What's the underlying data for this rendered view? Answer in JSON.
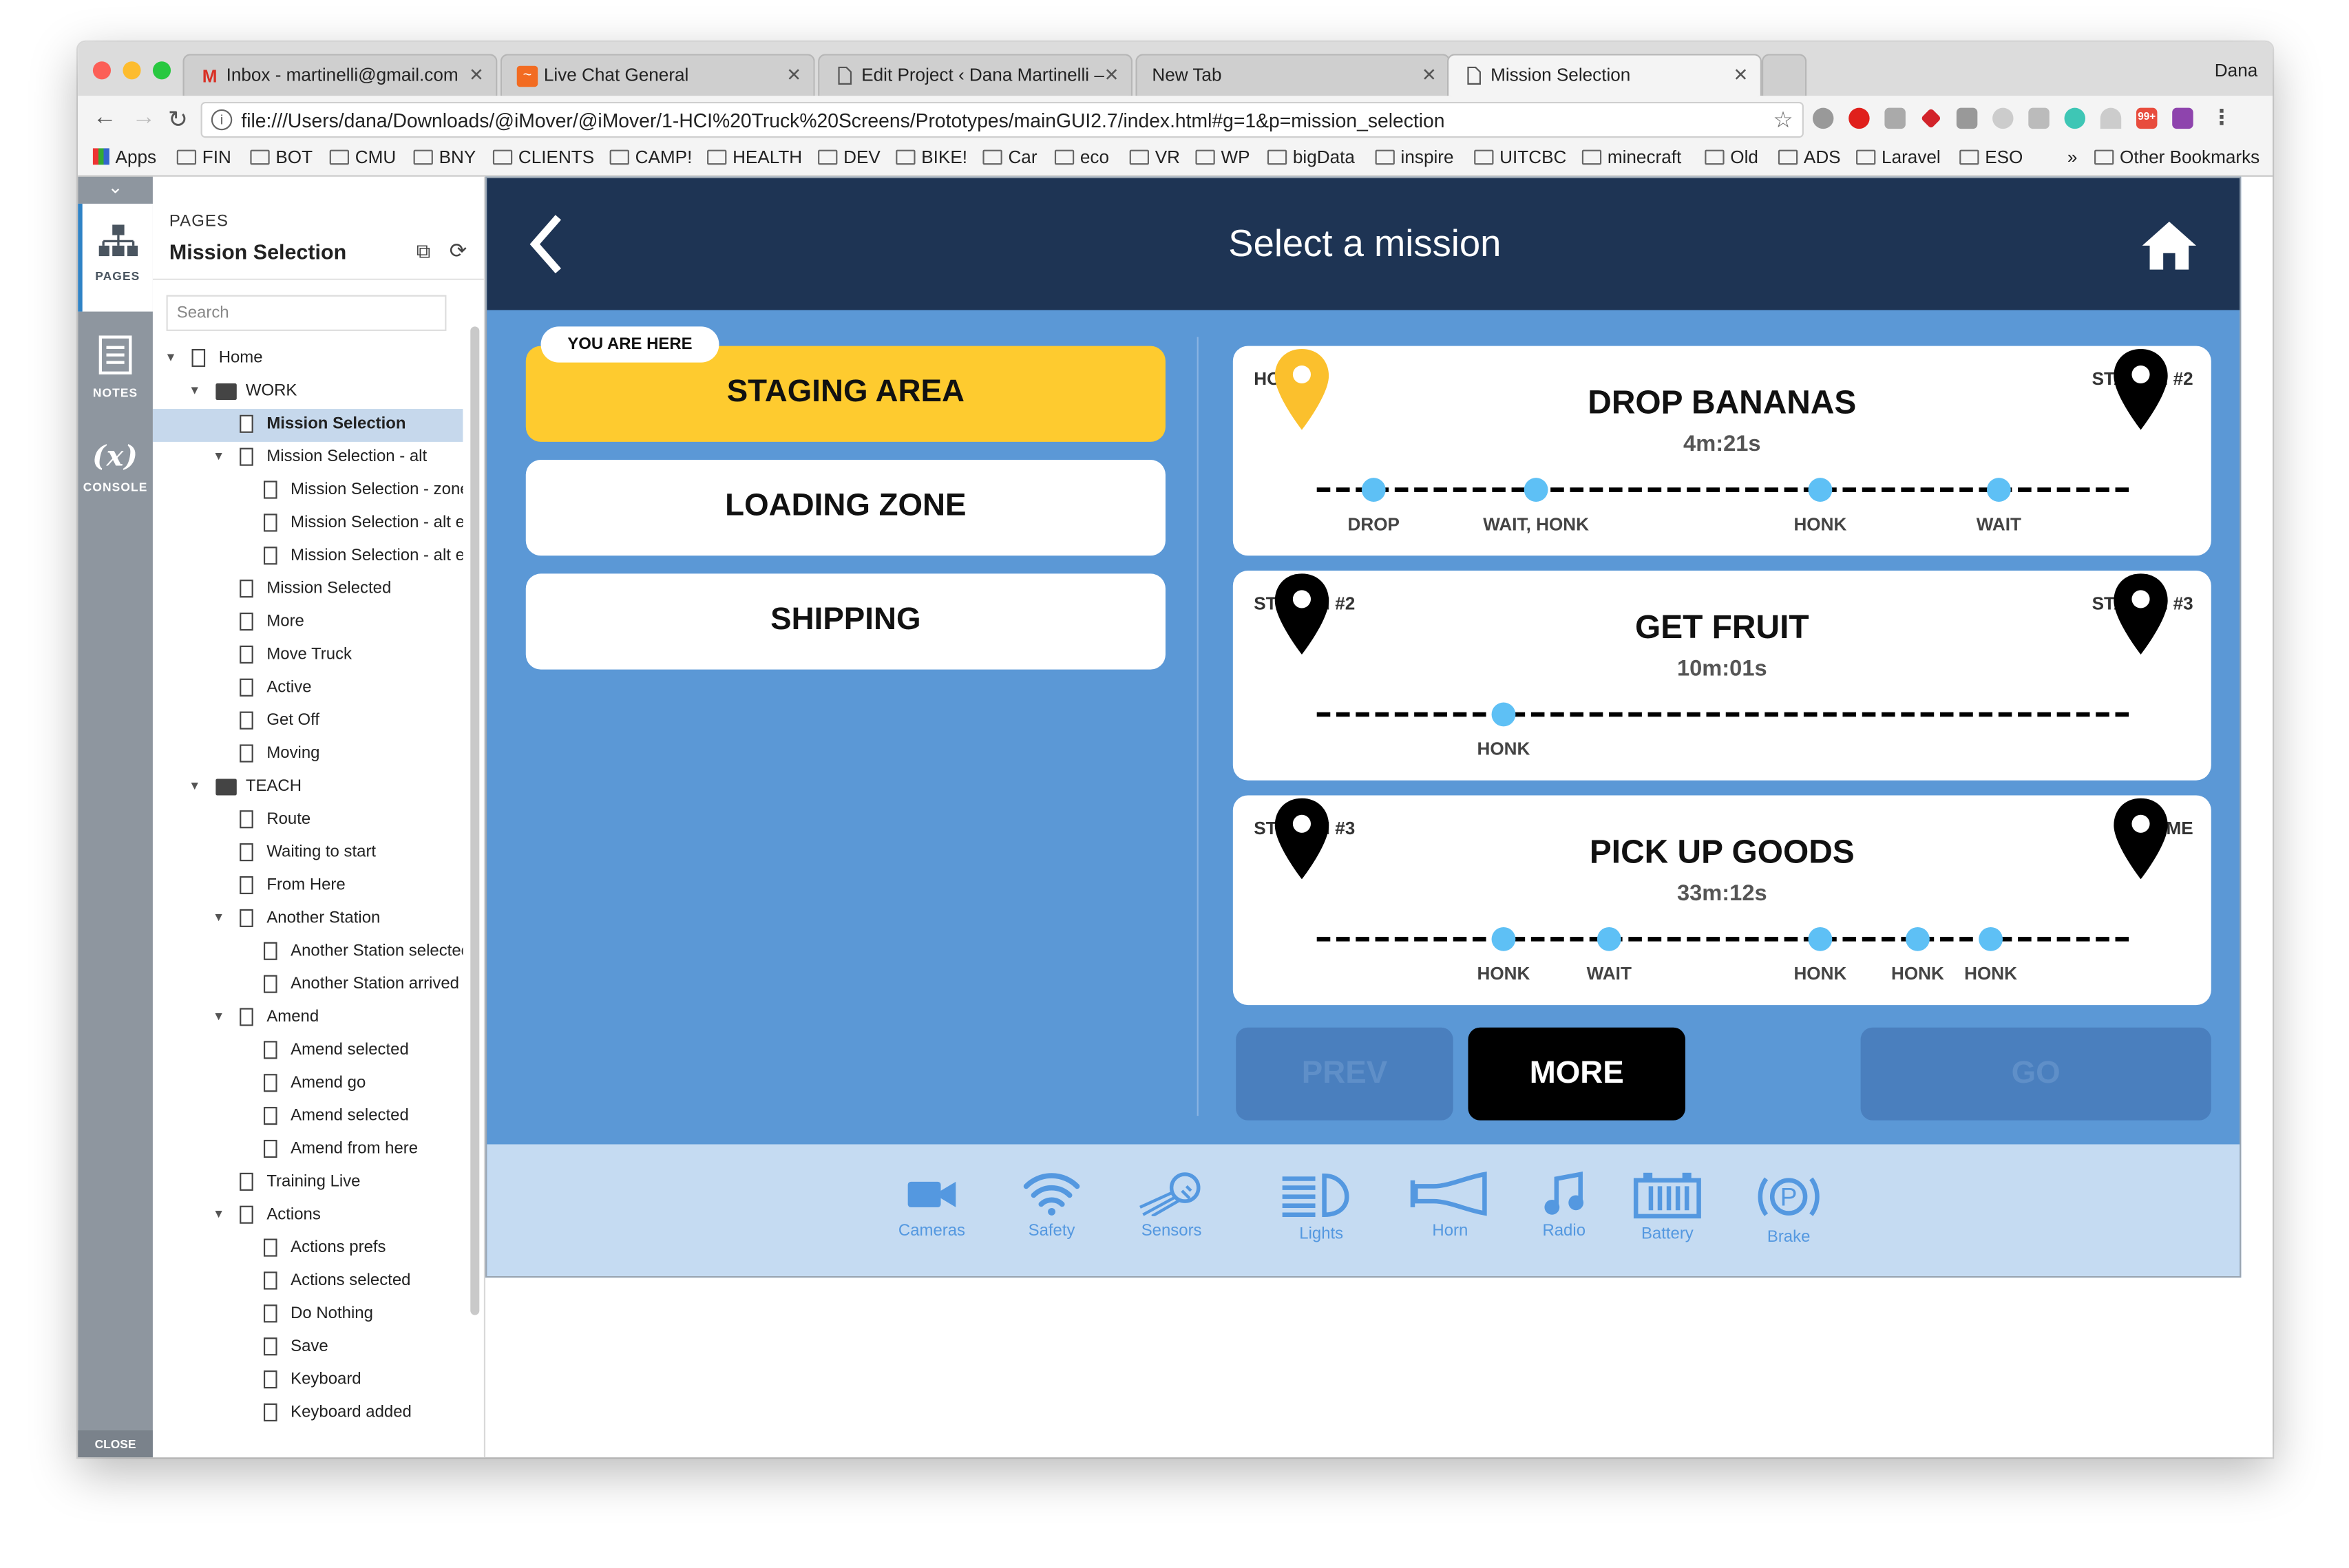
{
  "browser": {
    "user": "Dana",
    "tabs": [
      {
        "label": "Inbox - martinelli@gmail.com",
        "icon": "gmail-icon"
      },
      {
        "label": "Live Chat General",
        "icon": "chat-app-icon"
      },
      {
        "label": "Edit Project ‹ Dana Martinelli –",
        "icon": "document-icon"
      },
      {
        "label": "New Tab",
        "icon": ""
      },
      {
        "label": "Mission Selection",
        "icon": "document-icon"
      }
    ],
    "url": "file:///Users/dana/Downloads/@iMover/@iMover/1-HCI%20Truck%20Screens/Prototypes/mainGUI2.7/index.html#g=1&p=mission_selection",
    "bookmarks": [
      "Apps",
      "FIN",
      "BOT",
      "CMU",
      "BNY",
      "CLIENTS",
      "CAMP!",
      "HEALTH",
      "DEV",
      "BIKE!",
      "Car",
      "eco",
      "VR",
      "WP",
      "bigData",
      "inspire",
      "UITCBC",
      "minecraft",
      "Old",
      "ADS",
      "Laravel",
      "ESO"
    ],
    "more_bookmarks": "»",
    "other_bookmarks": "Other Bookmarks",
    "extension_badge": "99+"
  },
  "axure": {
    "rail": [
      {
        "label": "PAGES",
        "icon": "sitemap-icon"
      },
      {
        "label": "NOTES",
        "icon": "notes-icon"
      },
      {
        "label": "CONSOLE",
        "icon": "variable-icon",
        "glyph": "(x)"
      }
    ],
    "close_label": "CLOSE",
    "pages_header": "PAGES",
    "pages_title": "Mission Selection",
    "search_placeholder": "Search",
    "tree": [
      {
        "label": "Home",
        "type": "page",
        "level": 0,
        "toggle": true
      },
      {
        "label": "WORK",
        "type": "folder",
        "level": 1,
        "toggle": true
      },
      {
        "label": "Mission Selection",
        "type": "page",
        "level": 2,
        "toggle": false,
        "selected": true
      },
      {
        "label": "Mission Selection - alt",
        "type": "page",
        "level": 2,
        "toggle": true
      },
      {
        "label": "Mission Selection - zone",
        "type": "page",
        "level": 3,
        "toggle": false
      },
      {
        "label": "Mission Selection - alt e",
        "type": "page",
        "level": 3,
        "toggle": false
      },
      {
        "label": "Mission Selection - alt e",
        "type": "page",
        "level": 3,
        "toggle": false
      },
      {
        "label": "Mission Selected",
        "type": "page",
        "level": 2,
        "toggle": false
      },
      {
        "label": "More",
        "type": "page",
        "level": 2,
        "toggle": false
      },
      {
        "label": "Move Truck",
        "type": "page",
        "level": 2,
        "toggle": false
      },
      {
        "label": "Active",
        "type": "page",
        "level": 2,
        "toggle": false
      },
      {
        "label": "Get Off",
        "type": "page",
        "level": 2,
        "toggle": false
      },
      {
        "label": "Moving",
        "type": "page",
        "level": 2,
        "toggle": false
      },
      {
        "label": "TEACH",
        "type": "folder",
        "level": 1,
        "toggle": true
      },
      {
        "label": "Route",
        "type": "page",
        "level": 2,
        "toggle": false
      },
      {
        "label": "Waiting to start",
        "type": "page",
        "level": 2,
        "toggle": false
      },
      {
        "label": "From Here",
        "type": "page",
        "level": 2,
        "toggle": false
      },
      {
        "label": "Another Station",
        "type": "page",
        "level": 2,
        "toggle": true
      },
      {
        "label": "Another Station selected",
        "type": "page",
        "level": 3,
        "toggle": false
      },
      {
        "label": "Another Station arrived",
        "type": "page",
        "level": 3,
        "toggle": false
      },
      {
        "label": "Amend",
        "type": "page",
        "level": 2,
        "toggle": true
      },
      {
        "label": "Amend selected",
        "type": "page",
        "level": 3,
        "toggle": false
      },
      {
        "label": "Amend go",
        "type": "page",
        "level": 3,
        "toggle": false
      },
      {
        "label": "Amend selected",
        "type": "page",
        "level": 3,
        "toggle": false
      },
      {
        "label": "Amend from here",
        "type": "page",
        "level": 3,
        "toggle": false
      },
      {
        "label": "Training Live",
        "type": "page",
        "level": 2,
        "toggle": false
      },
      {
        "label": "Actions",
        "type": "page",
        "level": 2,
        "toggle": true
      },
      {
        "label": "Actions prefs",
        "type": "page",
        "level": 3,
        "toggle": false
      },
      {
        "label": "Actions selected",
        "type": "page",
        "level": 3,
        "toggle": false
      },
      {
        "label": "Do Nothing",
        "type": "page",
        "level": 3,
        "toggle": false
      },
      {
        "label": "Save",
        "type": "page",
        "level": 3,
        "toggle": false
      },
      {
        "label": "Keyboard",
        "type": "page",
        "level": 3,
        "toggle": false
      },
      {
        "label": "Keyboard added",
        "type": "page",
        "level": 3,
        "toggle": false
      }
    ]
  },
  "app": {
    "title": "Select a mission",
    "you_are_here": "YOU ARE HERE",
    "locations": [
      {
        "label": "STAGING AREA",
        "active": true
      },
      {
        "label": "LOADING ZONE",
        "active": false
      },
      {
        "label": "SHIPPING",
        "active": false
      }
    ],
    "missions": [
      {
        "title": "DROP BANANAS",
        "duration": "4m:21s",
        "start": "HOME",
        "end": "STATION #2",
        "start_pin_color": "#fbc02d",
        "waypoints": [
          {
            "label": "DROP",
            "pos": 0.07
          },
          {
            "label": "WAIT, HONK",
            "pos": 0.27
          },
          {
            "label": "HONK",
            "pos": 0.62
          },
          {
            "label": "WAIT",
            "pos": 0.84
          }
        ]
      },
      {
        "title": "GET FRUIT",
        "duration": "10m:01s",
        "start": "STATION #2",
        "end": "STATION #3",
        "start_pin_color": "#000000",
        "waypoints": [
          {
            "label": "HONK",
            "pos": 0.23
          }
        ]
      },
      {
        "title": "PICK UP GOODS",
        "duration": "33m:12s",
        "start": "STATION #3",
        "end": "HOME",
        "start_pin_color": "#000000",
        "waypoints": [
          {
            "label": "HONK",
            "pos": 0.23
          },
          {
            "label": "WAIT",
            "pos": 0.36
          },
          {
            "label": "HONK",
            "pos": 0.62
          },
          {
            "label": "HONK",
            "pos": 0.74
          },
          {
            "label": "HONK",
            "pos": 0.83
          }
        ]
      }
    ],
    "buttons": {
      "prev": "PREV",
      "more": "MORE",
      "go": "GO"
    },
    "controls": [
      {
        "label": "Cameras",
        "icon": "camera-icon"
      },
      {
        "label": "Safety",
        "icon": "wifi-icon"
      },
      {
        "label": "Sensors",
        "icon": "sensor-icon"
      },
      {
        "label": "Lights",
        "icon": "headlight-icon"
      },
      {
        "label": "Horn",
        "icon": "horn-icon"
      },
      {
        "label": "Radio",
        "icon": "music-note-icon"
      },
      {
        "label": "Battery",
        "icon": "battery-icon"
      },
      {
        "label": "Brake",
        "icon": "parking-brake-icon"
      }
    ],
    "colors": {
      "header": "#1e3454",
      "background": "#5b98d6",
      "active_location": "#fecb2f",
      "waypoint": "#5ec0f5",
      "bottom_bar": "#c5dbf2",
      "icon": "#5498e0"
    }
  }
}
